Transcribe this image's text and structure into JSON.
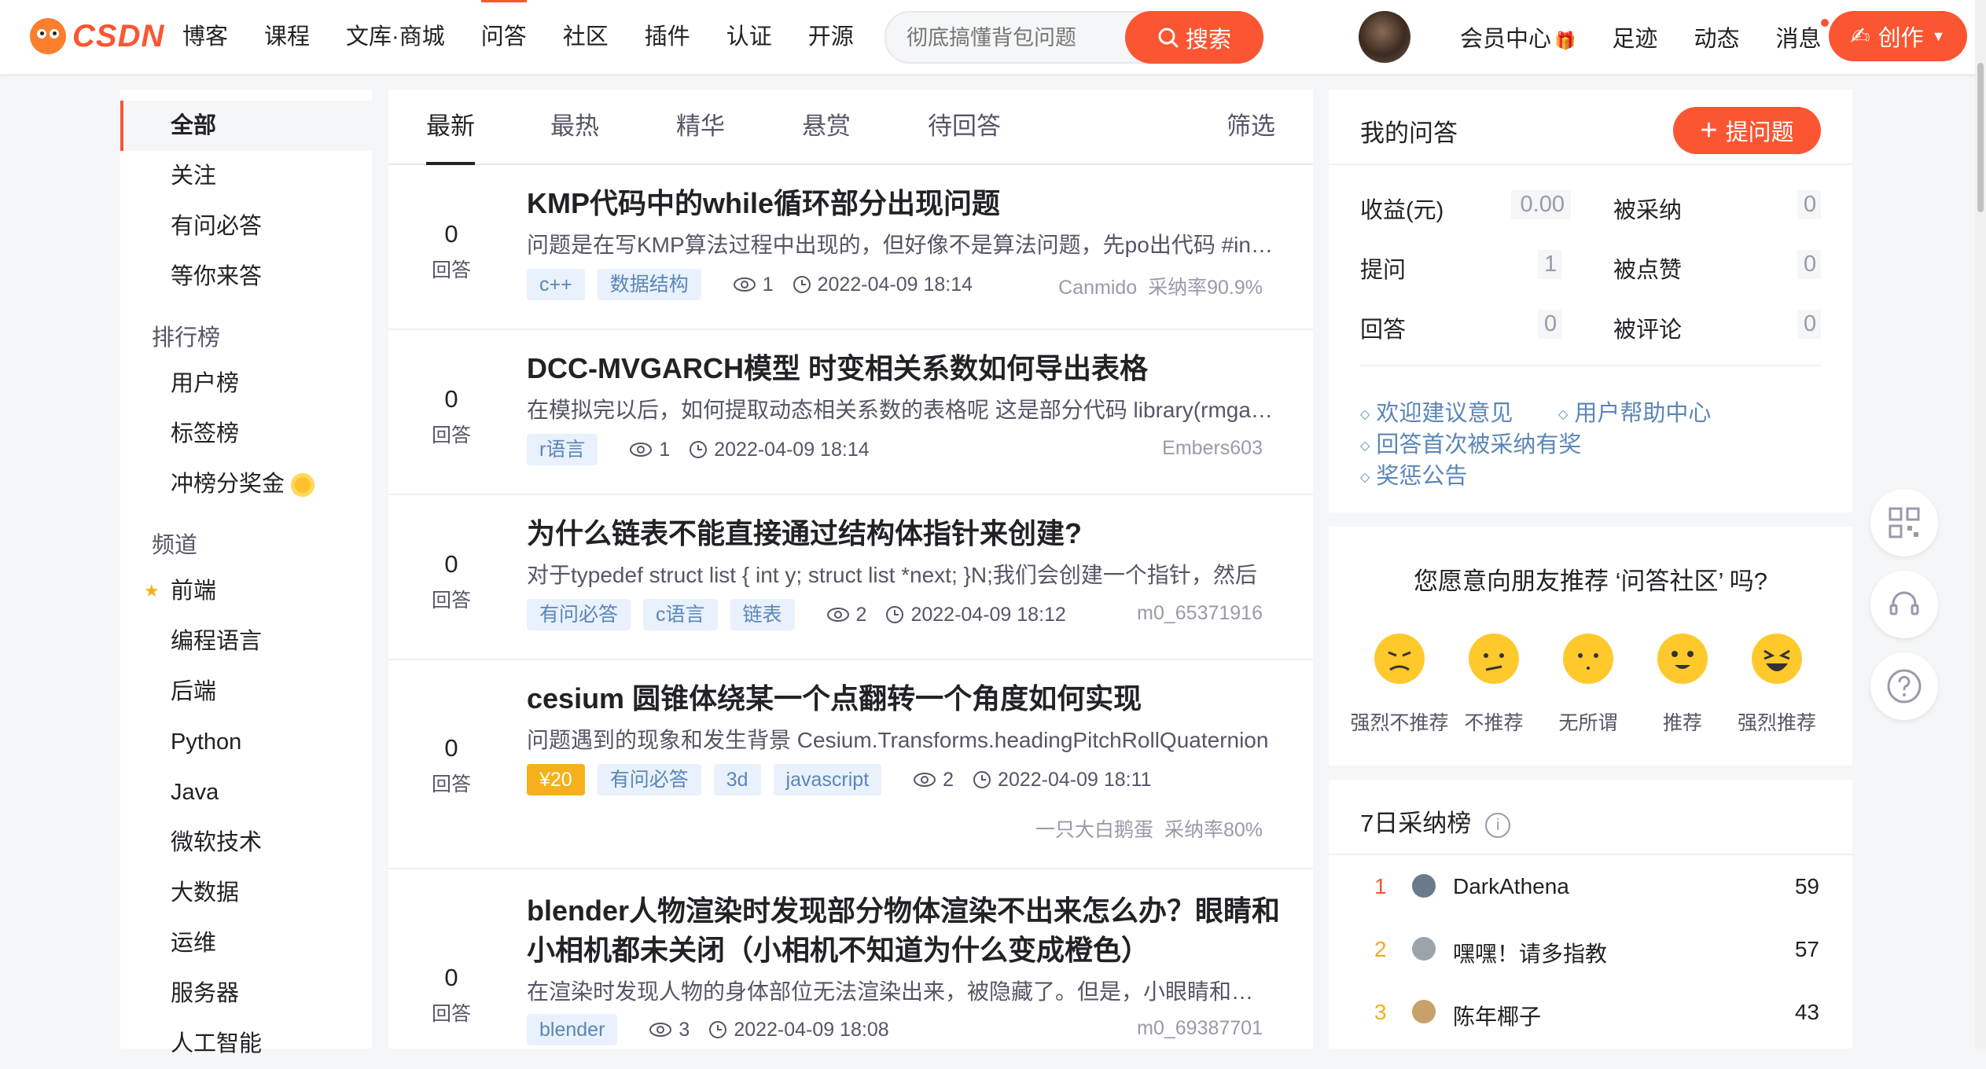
{
  "brand": {
    "logo_text": "CSDN"
  },
  "nav": {
    "items": [
      "博客",
      "课程",
      "文库·商城",
      "问答",
      "社区",
      "插件",
      "认证",
      "开源"
    ]
  },
  "search": {
    "placeholder": "彻底搞懂背包问题",
    "button": "搜索"
  },
  "top_links": {
    "member": "会员中心",
    "footprint": "足迹",
    "dynamic": "动态",
    "message": "消息",
    "create": "创作"
  },
  "sidebar": {
    "items": [
      "全部",
      "关注",
      "有问必答",
      "等你来答"
    ],
    "ranking_head": "排行榜",
    "ranking": [
      "用户榜",
      "标签榜",
      "冲榜分奖金"
    ],
    "channel_head": "频道",
    "channels": [
      "前端",
      "编程语言",
      "后端",
      "Python",
      "Java",
      "微软技术",
      "大数据",
      "运维",
      "服务器",
      "人工智能"
    ]
  },
  "tabs": {
    "items": [
      "最新",
      "最热",
      "精华",
      "悬赏",
      "待回答"
    ],
    "filter": "筛选"
  },
  "questions": [
    {
      "count": "0",
      "count_label": "回答",
      "title": "KMP代码中的while循环部分出现问题",
      "desc": "问题是在写KMP算法过程中出现的，但好像不是算法问题，先po出代码 #include",
      "tags": [
        "c++",
        "数据结构"
      ],
      "views": "1",
      "time": "2022-04-09 18:14",
      "author": "Canmido",
      "rate": "采纳率90.9%"
    },
    {
      "count": "0",
      "count_label": "回答",
      "title": "DCC-MVGARCH模型 时变相关系数如何导出表格",
      "desc": "在模拟完以后，如何提取动态相关系数的表格呢 这是部分代码 library(rmgarch)",
      "tags": [
        "r语言"
      ],
      "views": "1",
      "time": "2022-04-09 18:14",
      "author": "Embers603",
      "rate": ""
    },
    {
      "count": "0",
      "count_label": "回答",
      "title": "为什么链表不能直接通过结构体指针来创建?",
      "desc": "对于typedef struct list { int y; struct list *next; }N;我们会创建一个指针，然后",
      "tags": [
        "有问必答",
        "c语言",
        "链表"
      ],
      "views": "2",
      "time": "2022-04-09 18:12",
      "author": "m0_65371916",
      "rate": ""
    },
    {
      "count": "0",
      "count_label": "回答",
      "title": "cesium 圆锥体绕某一个点翻转一个角度如何实现",
      "desc": "问题遇到的现象和发生背景 Cesium.Transforms.headingPitchRollQuaternion",
      "bounty": "¥20",
      "tags": [
        "有问必答",
        "3d",
        "javascript"
      ],
      "views": "2",
      "time": "2022-04-09 18:11",
      "author": "一只大白鹅蛋",
      "rate": "采纳率80%"
    },
    {
      "count": "0",
      "count_label": "回答",
      "title": "blender人物渲染时发现部分物体渲染不出来怎么办？眼睛和小相机都未关闭（小相机不知道为什么变成橙色）",
      "desc": "在渲染时发现人物的身体部位无法渲染出来，被隐藏了。但是，小眼睛和照相机都没有关闭",
      "tags": [
        "blender"
      ],
      "views": "3",
      "time": "2022-04-09 18:08",
      "author": "m0_69387701",
      "rate": ""
    }
  ],
  "my_qa": {
    "title": "我的问答",
    "ask_button": "提问题",
    "stats": [
      {
        "label": "收益(元)",
        "value": "0.00"
      },
      {
        "label": "被采纳",
        "value": "0"
      },
      {
        "label": "提问",
        "value": "1"
      },
      {
        "label": "被点赞",
        "value": "0"
      },
      {
        "label": "回答",
        "value": "0"
      },
      {
        "label": "被评论",
        "value": "0"
      }
    ],
    "links": [
      "欢迎建议意见",
      "用户帮助中心",
      "回答首次被采纳有奖",
      "奖惩公告"
    ]
  },
  "recommend": {
    "question": "您愿意向朋友推荐 ‘问答社区’ 吗?",
    "options": [
      "强烈不推荐",
      "不推荐",
      "无所谓",
      "推荐",
      "强烈推荐"
    ]
  },
  "rank7": {
    "title": "7日采纳榜",
    "rows": [
      {
        "no": "1",
        "name": "DarkAthena",
        "value": "59"
      },
      {
        "no": "2",
        "name": "嘿嘿！请多指教",
        "value": "57"
      },
      {
        "no": "3",
        "name": "陈年椰子",
        "value": "43"
      }
    ]
  },
  "colors": {
    "accent": "#fc5531",
    "tag_bg": "#e8f1fc",
    "tag_text": "#5b86b7",
    "bounty": "#f5b01b"
  }
}
